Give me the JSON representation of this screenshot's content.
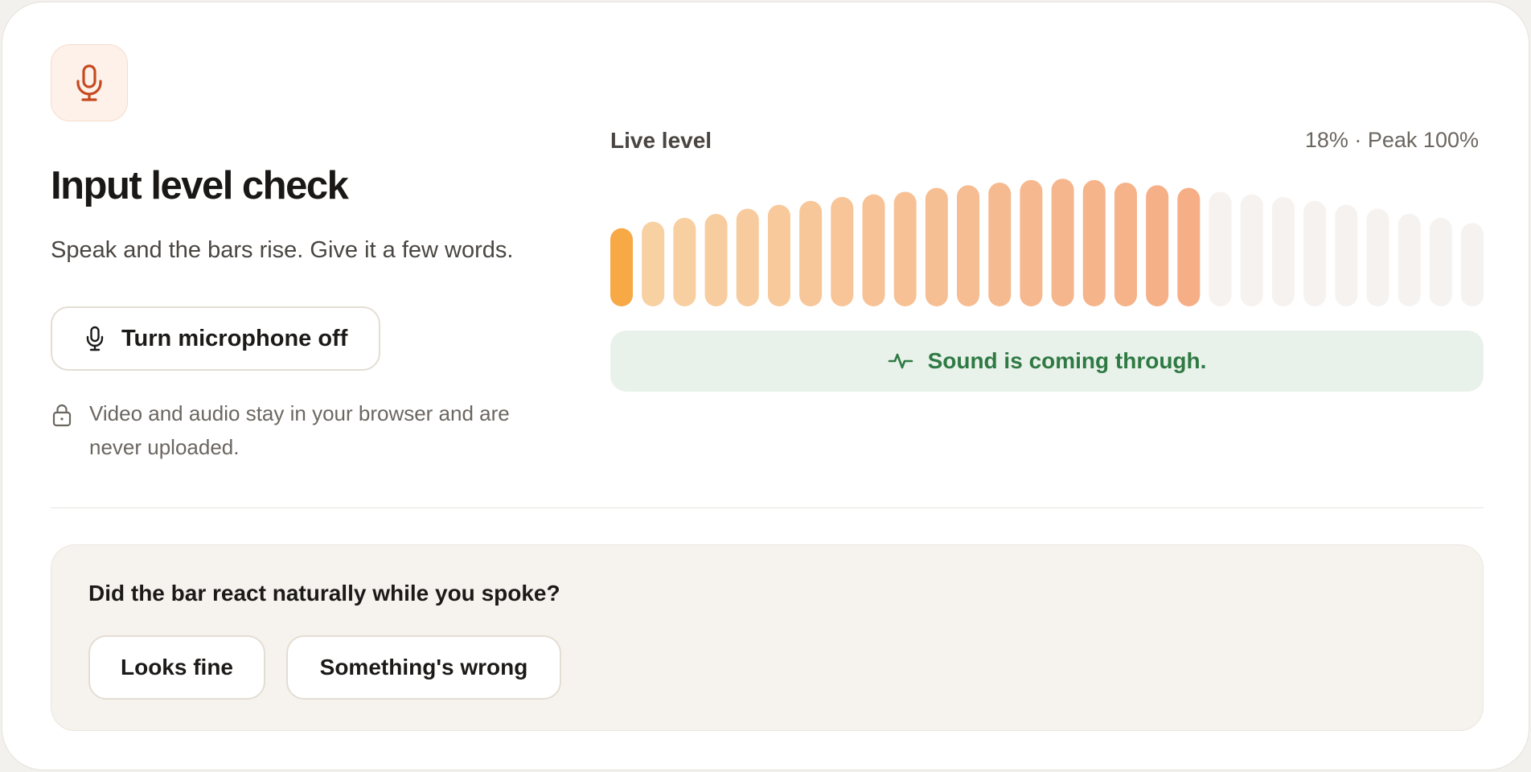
{
  "header": {
    "icon": "microphone-icon",
    "title": "Input level check",
    "subtitle": "Speak and the bars rise. Give it a few words."
  },
  "mic_toggle": {
    "icon": "microphone-icon",
    "label": "Turn microphone off"
  },
  "privacy": {
    "icon": "lock-icon",
    "text": "Video and audio stay in your browser and are never uploaded."
  },
  "meter": {
    "label": "Live level",
    "readout": "18% · Peak 100%",
    "bar_count": 28,
    "active_bars": 19,
    "levels": [
      0.6,
      0.65,
      0.68,
      0.71,
      0.75,
      0.78,
      0.81,
      0.84,
      0.86,
      0.88,
      0.91,
      0.93,
      0.95,
      0.97,
      0.98,
      0.97,
      0.95,
      0.93,
      0.91,
      0.88,
      0.86,
      0.84,
      0.81,
      0.78,
      0.75,
      0.71,
      0.68,
      0.64
    ],
    "colors": {
      "first_active": "#f6a945",
      "active_start": "#f7d1a2",
      "active_end": "#f6ae86",
      "inactive": "#f6f2ef"
    }
  },
  "status": {
    "icon": "activity-pulse-icon",
    "text": "Sound is coming through.",
    "color": "#2f7a44"
  },
  "feedback": {
    "question": "Did the bar react naturally while you spoke?",
    "options": [
      "Looks fine",
      "Something's wrong"
    ]
  },
  "colors": {
    "accent": "#c64a1f",
    "badge_bg": "#fdf1ea",
    "success_bg": "#e9f2ea"
  }
}
